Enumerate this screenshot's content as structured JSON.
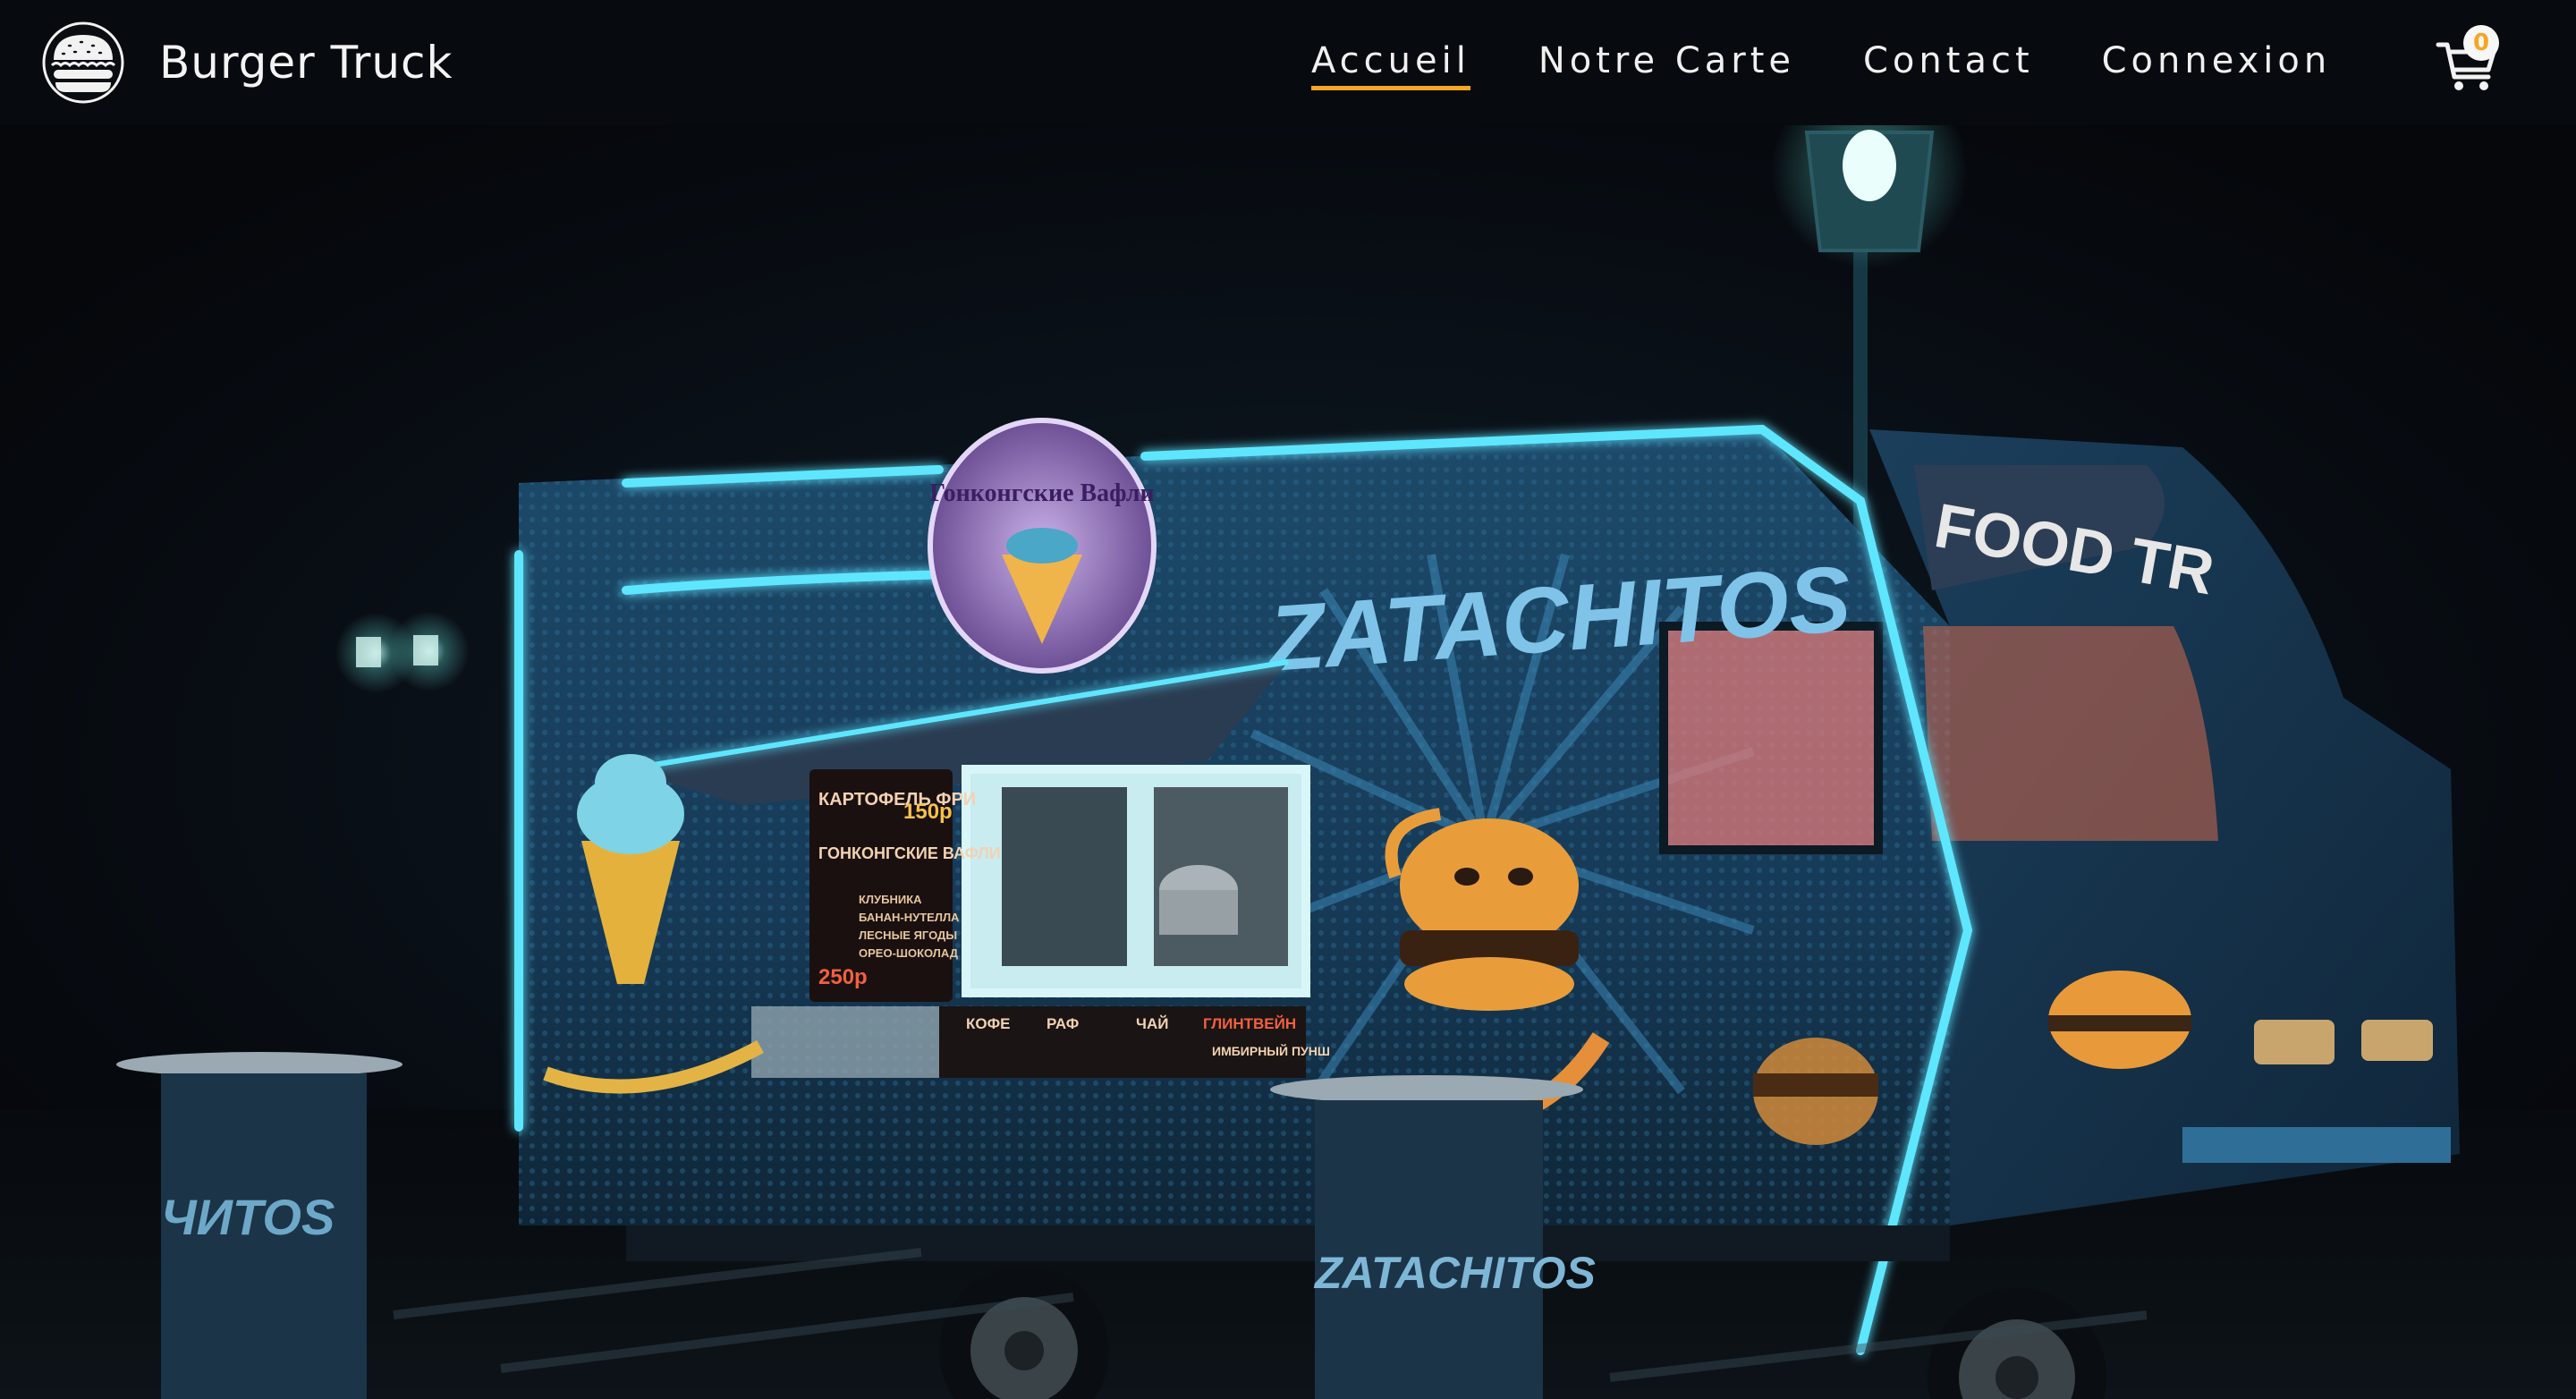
{
  "brand": {
    "name": "Burger Truck",
    "logo_icon": "burger-icon"
  },
  "nav": {
    "items": [
      {
        "label": "Accueil",
        "active": true
      },
      {
        "label": "Notre Carte",
        "active": false
      },
      {
        "label": "Contact",
        "active": false
      },
      {
        "label": "Connexion",
        "active": false
      }
    ],
    "active_underline_color": "#f6a623"
  },
  "cart": {
    "icon": "shopping-cart-icon",
    "count": "0",
    "badge_text_color": "#f6a623"
  },
  "hero": {
    "image": "night-food-truck-photo",
    "truck_name": "ZATACHITOS",
    "side_text": "FOOD TR",
    "sign_text": "Гонконгские Вафли",
    "menu_board": {
      "title_1": "КАРТОФЕЛЬ ФРИ",
      "price_1": "150р",
      "title_2": "ГОНКОНГСКИЕ ВАФЛИ",
      "items": [
        "КЛУБНИКА",
        "БАНАН-НУТЕЛЛА",
        "ЛЕСНЫЕ ЯГОДЫ",
        "ОРЕО-ШОКОЛАД"
      ],
      "price_2": "250р"
    },
    "drinks_board": [
      "КОФЕ",
      "РАФ",
      "ЧАЙ",
      "ГЛИНТВЕЙН",
      "ИМБИРНЫЙ ПУНШ"
    ],
    "barrel_text_left": "ЧИТОS",
    "barrel_text_right": "ZATACHITOS",
    "neon_color": "#3fd6f0"
  }
}
